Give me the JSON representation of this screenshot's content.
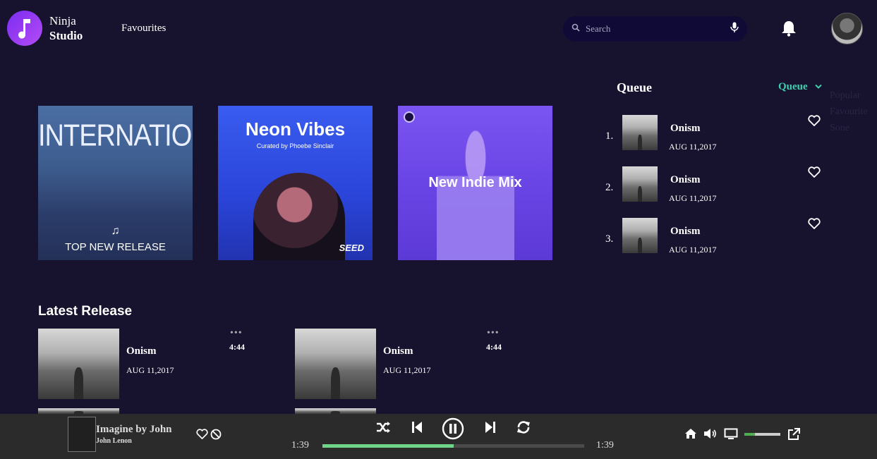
{
  "app": {
    "name_line1": "Ninja",
    "name_line2": "Studio"
  },
  "nav": {
    "favourites": "Favourites"
  },
  "search": {
    "placeholder": "Search"
  },
  "albums": [
    {
      "title": "INTERNATIONAL",
      "subtitle": "TOP NEW RELEASE"
    },
    {
      "title": "Neon Vibes",
      "subtitle": "Curated by Phoebe Sinclair",
      "badge": "SEED"
    },
    {
      "title": "New Indie Mix"
    }
  ],
  "queue": {
    "title": "Queue",
    "selector": "Queue",
    "overflow_lines": [
      "Popular",
      "Favourite",
      "Sone"
    ],
    "items": [
      {
        "num": "1.",
        "title": "Onism",
        "date": "AUG 11,2017"
      },
      {
        "num": "2.",
        "title": "Onism",
        "date": "AUG 11,2017"
      },
      {
        "num": "3.",
        "title": "Onism",
        "date": "AUG 11,2017"
      }
    ]
  },
  "latest": {
    "title": "Latest Release",
    "items": [
      {
        "title": "Onism",
        "date": "AUG 11,2017",
        "dots": "•••",
        "duration": "4:44"
      },
      {
        "title": "Onism",
        "date": "AUG 11,2017",
        "dots": "•••",
        "duration": "4:44"
      }
    ]
  },
  "player": {
    "title": "Imagine by John",
    "artist": "John Lenon",
    "elapsed": "1:39",
    "total": "1:39",
    "progress": 0.5,
    "volume": 0.3
  },
  "colors": {
    "background": "#17122e",
    "accent": "#3fd0b0",
    "progress": "#6fd38a",
    "brand": "#8a34f2"
  }
}
